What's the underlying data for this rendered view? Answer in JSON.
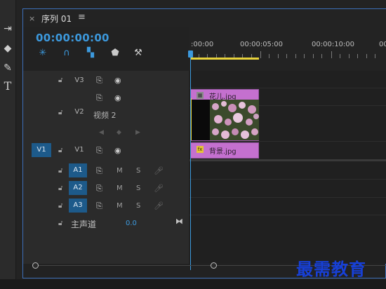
{
  "panel": {
    "close_glyph": "×",
    "sequence_name": "序列 01",
    "menu_glyph": "≡",
    "timecode": "00:00:00:00"
  },
  "ruler": {
    "labels": [
      ":00:00",
      "00:00:05:00",
      "00:00:10:00",
      "00"
    ]
  },
  "tracks": {
    "video": [
      {
        "name": "V3",
        "label_text": ""
      },
      {
        "name": "",
        "label_text": ""
      },
      {
        "name": "V2",
        "label_text": "视频 2"
      },
      {
        "name": "V1",
        "label_text": "",
        "source_patch": "V1"
      }
    ],
    "audio": [
      {
        "name": "A1",
        "mute": "M",
        "solo": "S"
      },
      {
        "name": "A2",
        "mute": "M",
        "solo": "S"
      },
      {
        "name": "A3",
        "mute": "M",
        "solo": "S"
      }
    ],
    "master": {
      "label": "主声道",
      "value": "0.0"
    }
  },
  "clips": {
    "v2_clip_name": "花儿.jpg",
    "v1_clip_name": "背景.jpg",
    "fx_badge": "fx"
  },
  "watermark": "最需教育",
  "colors": {
    "accent_blue": "#3c99dd",
    "clip_pink": "#c470cf",
    "workbar_yellow": "#e7d23b",
    "watermark_blue": "#1740d8"
  }
}
